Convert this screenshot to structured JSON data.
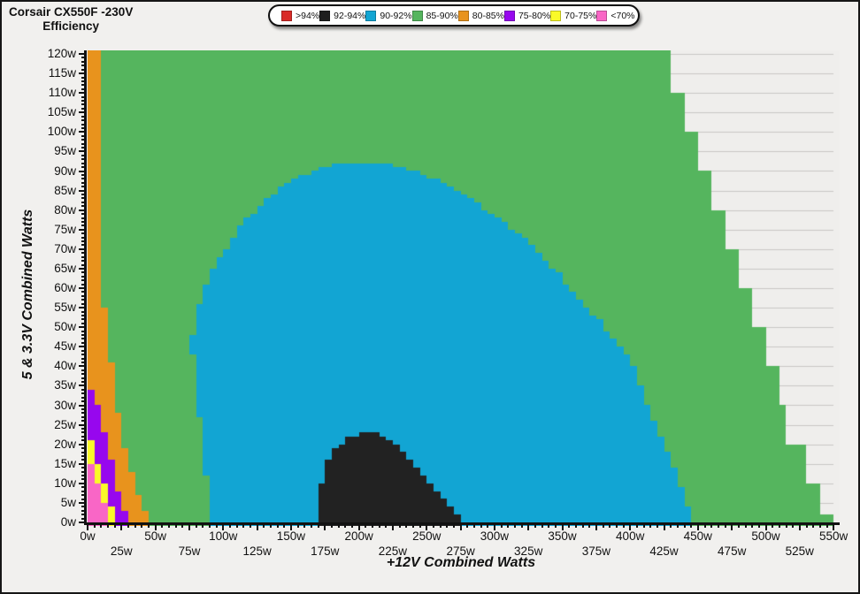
{
  "title": {
    "line1": "Corsair CX550F -230V",
    "line2": "Efficiency"
  },
  "legend": {
    "items": [
      {
        "label": ">94%",
        "color": "#d92b28"
      },
      {
        "label": "92-94%",
        "color": "#1e1e1e"
      },
      {
        "label": "90-92%",
        "color": "#12a5d3"
      },
      {
        "label": "85-90%",
        "color": "#55b55e"
      },
      {
        "label": "80-85%",
        "color": "#e8931d"
      },
      {
        "label": "75-80%",
        "color": "#9707ee"
      },
      {
        "label": "70-75%",
        "color": "#fafa28"
      },
      {
        "label": "<70%",
        "color": "#f966c6"
      }
    ]
  },
  "axes": {
    "x": {
      "title": "+12V Combined Watts",
      "min": 0,
      "max": 550,
      "major_step": 25,
      "minor_step": 5,
      "ticks": [
        "0w",
        "25w",
        "50w",
        "75w",
        "100w",
        "125w",
        "150w",
        "175w",
        "200w",
        "225w",
        "250w",
        "275w",
        "300w",
        "325w",
        "350w",
        "375w",
        "400w",
        "425w",
        "450w",
        "475w",
        "500w",
        "525w",
        "550w"
      ]
    },
    "y": {
      "title": "5 & 3.3V Combined Watts",
      "min": 0,
      "max": 120,
      "major_step": 5,
      "minor_step": 1,
      "ticks": [
        "0w",
        "5w",
        "10w",
        "15w",
        "20w",
        "25w",
        "30w",
        "35w",
        "40w",
        "45w",
        "50w",
        "55w",
        "60w",
        "65w",
        "70w",
        "75w",
        "80w",
        "85w",
        "90w",
        "95w",
        "100w",
        "105w",
        "110w",
        "115w",
        "120w"
      ]
    }
  },
  "chart_data": {
    "type": "heatmap",
    "title": "Corsair CX550F -230V Efficiency",
    "xlabel": "+12V Combined Watts",
    "ylabel": "5 & 3.3V Combined Watts",
    "xlim": [
      0,
      550
    ],
    "ylim": [
      0,
      120
    ],
    "grid": "horizontal gridlines every 5w",
    "legend_position": "top",
    "bands": [
      ">94%",
      "92-94%",
      "90-92%",
      "85-90%",
      "80-85%",
      "75-80%",
      "70-75%",
      "<70%"
    ],
    "cell": {
      "w": 5,
      "h": 1
    },
    "regions": {
      "note": "All coordinates in watts. Envelope = PSU max combined output staircase (x+y ~ 550w). Band edges are polylines [y,x]; a cell left of the edge belongs to that band. black_92_94 is a dome given by top boundary y_top(x). blue_90_92 is a closed polygon [x,y].",
      "envelope_steps": [
        [
          0,
          2.5,
          549
        ],
        [
          2.5,
          10,
          538
        ],
        [
          10,
          20,
          528
        ],
        [
          20,
          30,
          517
        ],
        [
          30,
          40,
          508
        ],
        [
          40,
          50,
          499
        ],
        [
          50,
          60,
          489
        ],
        [
          60,
          70,
          479
        ],
        [
          70,
          80,
          469
        ],
        [
          80,
          90,
          459
        ],
        [
          90,
          100,
          450
        ],
        [
          100,
          110,
          440
        ],
        [
          110,
          122,
          429
        ]
      ],
      "pink_lt70": [
        [
          0,
          17.5
        ],
        [
          5,
          12.5
        ],
        [
          10,
          7.5
        ],
        [
          14,
          4
        ],
        [
          17.5,
          0
        ]
      ],
      "yellow_70_75": [
        [
          0,
          21.5
        ],
        [
          5,
          16.5
        ],
        [
          10,
          12.5
        ],
        [
          15,
          8
        ],
        [
          18.5,
          4
        ],
        [
          24.5,
          0
        ]
      ],
      "purple_75_80": [
        [
          0,
          30
        ],
        [
          2.5,
          28.5
        ],
        [
          7,
          23.5
        ],
        [
          12,
          20
        ],
        [
          17,
          16.5
        ],
        [
          22,
          13.5
        ],
        [
          28,
          9
        ],
        [
          32,
          5.5
        ],
        [
          36.5,
          0
        ]
      ],
      "orange_80_85": [
        [
          0,
          47
        ],
        [
          3,
          42
        ],
        [
          5,
          40
        ],
        [
          10,
          35
        ],
        [
          15,
          31
        ],
        [
          20,
          27
        ],
        [
          25,
          24
        ],
        [
          30,
          21.5
        ],
        [
          35,
          19.5
        ],
        [
          40,
          18
        ],
        [
          45,
          16
        ],
        [
          50,
          13.5
        ],
        [
          55,
          12.5
        ],
        [
          60,
          11.5
        ],
        [
          68,
          9
        ],
        [
          75,
          8.5
        ],
        [
          88,
          8.5
        ],
        [
          92,
          12.5
        ],
        [
          97,
          12.5
        ],
        [
          99,
          10
        ],
        [
          105,
          10
        ],
        [
          122,
          10.5
        ]
      ],
      "black_92_94": {
        "x": [
          170,
          171,
          174,
          178,
          183,
          189,
          196,
          203,
          215,
          221,
          229,
          237,
          247,
          257,
          267,
          272,
          275
        ],
        "y_top": [
          0,
          8,
          13,
          16.5,
          19,
          21,
          22.3,
          22.7,
          22.7,
          21.7,
          19.3,
          16.3,
          12.7,
          8.7,
          4.3,
          2,
          0
        ]
      },
      "blue_90_92_polygon": [
        [
          92,
          0
        ],
        [
          88,
          10
        ],
        [
          85,
          21
        ],
        [
          81,
          30
        ],
        [
          78,
          40
        ],
        [
          77,
          46
        ],
        [
          79,
          52
        ],
        [
          84,
          58
        ],
        [
          89,
          62
        ],
        [
          95,
          67
        ],
        [
          102,
          70
        ],
        [
          111,
          75
        ],
        [
          124,
          80
        ],
        [
          140,
          85
        ],
        [
          160,
          89
        ],
        [
          180,
          91.5
        ],
        [
          200,
          92.3
        ],
        [
          220,
          91.7
        ],
        [
          240,
          90.3
        ],
        [
          258,
          87.5
        ],
        [
          280,
          83.5
        ],
        [
          301,
          78
        ],
        [
          323,
          73
        ],
        [
          336,
          68
        ],
        [
          349,
          63
        ],
        [
          366,
          55.5
        ],
        [
          379,
          51
        ],
        [
          390,
          46
        ],
        [
          401,
          41
        ],
        [
          408,
          35
        ],
        [
          416,
          27
        ],
        [
          424,
          21
        ],
        [
          429,
          17
        ],
        [
          436,
          11
        ],
        [
          441,
          6
        ],
        [
          446,
          0
        ]
      ]
    }
  },
  "colors": {
    "page_bg": "#f1f0ee",
    "plot_bg": "#efeeec",
    "grid": "#c9c7c4",
    "axis": "#121212",
    "green": "#55b55e",
    "blue": "#12a5d3",
    "black": "#222222",
    "orange": "#e8931d",
    "purple": "#9707ee",
    "yellow": "#fafa28",
    "pink": "#f966c6"
  }
}
